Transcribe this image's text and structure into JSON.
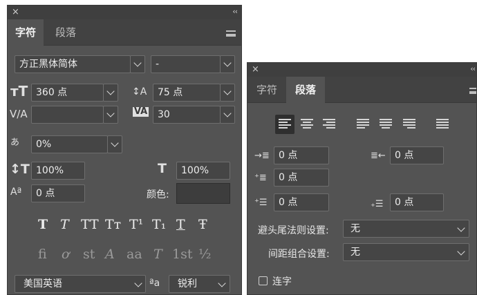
{
  "character_panel": {
    "close_glyph": "×",
    "collapse_glyph": "‹‹",
    "tabs": [
      {
        "label": "字符"
      },
      {
        "label": "段落"
      }
    ],
    "font_family": "方正黑体简体",
    "font_style": "-",
    "font_size": "360 点",
    "leading": "75 点",
    "kerning": "",
    "tracking": "30",
    "tsume": "0%",
    "vertical_scale": "100%",
    "horizontal_scale": "100%",
    "baseline_shift": "0 点",
    "color_label": "颜色:",
    "color_value": "#3d3d3d",
    "style_buttons": [
      "T",
      "T",
      "TT",
      "Tт",
      "T¹",
      "T₁",
      "T",
      "Ŧ"
    ],
    "opentype_buttons": [
      "ﬁ",
      "ơ",
      "st",
      "A",
      "aa",
      "T",
      "1st",
      "½"
    ],
    "language": "美国英语",
    "antialias_icon_text": "ªa",
    "antialias": "锐利"
  },
  "paragraph_panel": {
    "close_glyph": "×",
    "collapse_glyph": "‹‹",
    "tabs": [
      {
        "label": "字符"
      },
      {
        "label": "段落"
      }
    ],
    "alignment_selected": "align-left",
    "indent_left": "0 点",
    "indent_right": "0 点",
    "indent_first_line": "0 点",
    "space_before": "0 点",
    "space_after": "0 点",
    "kinsoku_label": "避头尾法则设置:",
    "kinsoku_value": "无",
    "mojikumi_label": "间距组合设置:",
    "mojikumi_value": "无",
    "hyphenate_label": "连字"
  }
}
